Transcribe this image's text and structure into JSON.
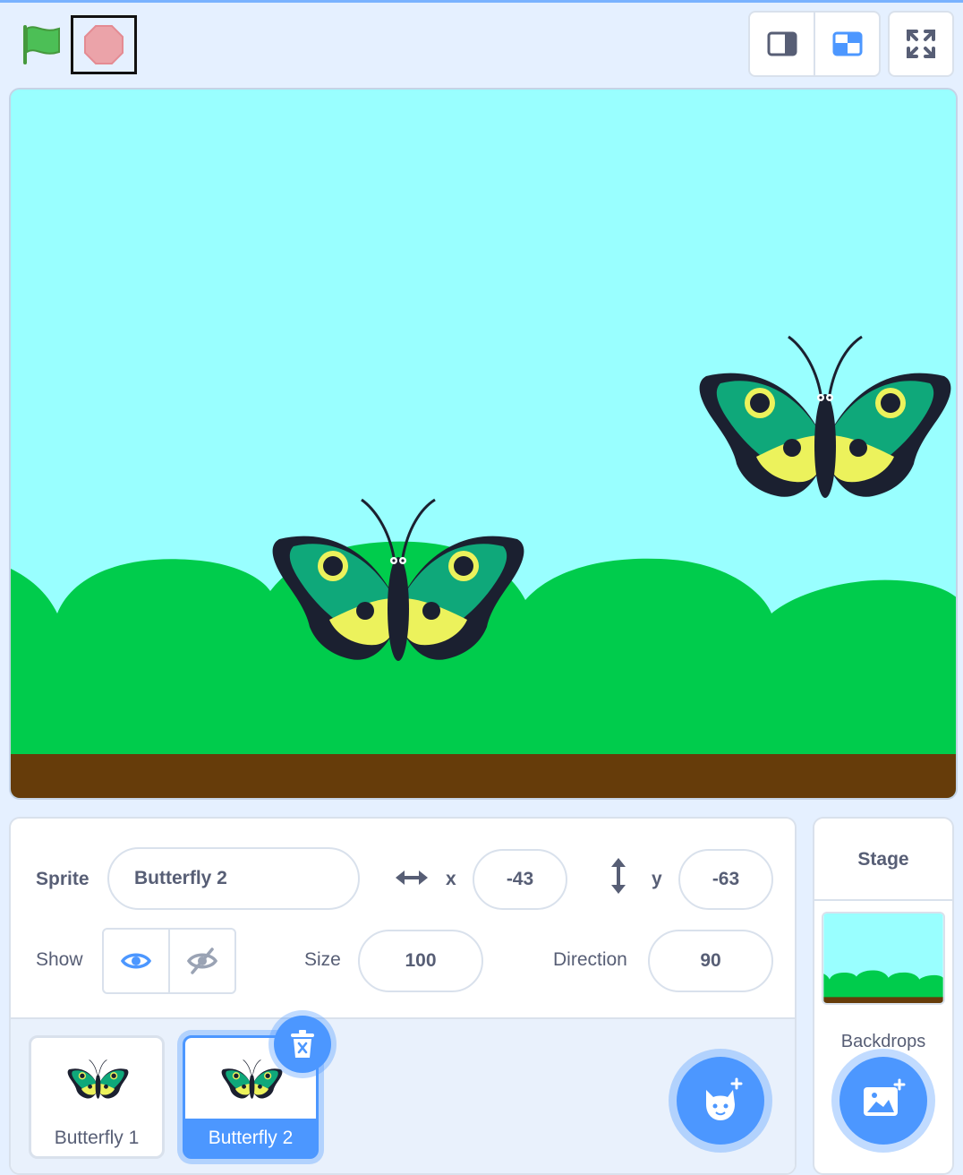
{
  "toolbar": {
    "green_flag_icon": "green-flag-icon",
    "stop_icon": "stop-icon",
    "layout_buttons": [
      "small-stage-icon",
      "normal-stage-icon"
    ],
    "fullscreen_icon": "fullscreen-icon"
  },
  "stage": {
    "backdrop": "Blue Sky",
    "sky_color": "#99ffff",
    "hill_color": "#00cc4c",
    "ground_color": "#663c0a"
  },
  "sprite_info": {
    "sprite_label": "Sprite",
    "sprite_name": "Butterfly 2",
    "x_label": "x",
    "x_value": "-43",
    "y_label": "y",
    "y_value": "-63",
    "show_label": "Show",
    "size_label": "Size",
    "size_value": "100",
    "direction_label": "Direction",
    "direction_value": "90"
  },
  "sprites": [
    {
      "name": "Butterfly 1",
      "selected": false
    },
    {
      "name": "Butterfly 2",
      "selected": true
    }
  ],
  "stage_pane": {
    "title": "Stage",
    "backdrops_label": "Backdrops"
  },
  "colors": {
    "accent": "#4c97ff",
    "text": "#575e75",
    "butterfly_green": "#0fa87a",
    "butterfly_yellow": "#ecf25c",
    "butterfly_dark": "#1b2030"
  }
}
